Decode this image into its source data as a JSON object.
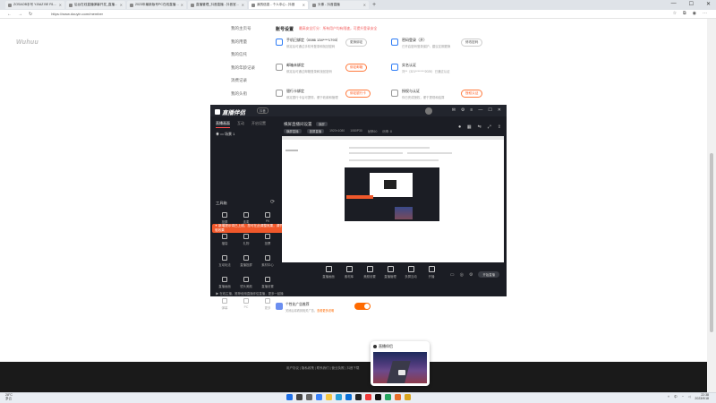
{
  "browser": {
    "tabs": [
      {
        "title": "ZOSAOB手写 Y-BAZ BE R10X...",
        "active": false
      },
      {
        "title": "后台在线直播弹幕开发_直播...",
        "active": false
      },
      {
        "title": "2023年最新版号PC在线直播弹幕...",
        "active": false
      },
      {
        "title": "直播管理_抖音直播 - 抖音官方...",
        "active": false
      },
      {
        "title": "我的信息 - 个人中心 - 抖音",
        "active": true
      },
      {
        "title": "头像 - 抖音直播",
        "active": false
      }
    ],
    "new_tab": "+",
    "url": "https://www.douyin.com/member",
    "nav": {
      "back": "←",
      "forward": "→",
      "reload": "↻"
    },
    "window_controls": {
      "min": "—",
      "max": "☐",
      "close": "✕"
    }
  },
  "page": {
    "logo_text": "Wuhuu",
    "side_menu": [
      "我的主页号",
      "我的用量",
      "我的信托",
      "我的年龄记录",
      "消费记录",
      "我的头衔"
    ],
    "section_title": "账号设置",
    "section_subtitle": "最高安全打分：所有用户均有限速，可提升登录安全",
    "settings": [
      {
        "title": "手机已绑定（0086 134****1793）",
        "desc": "绑定后可通过手机号登录和找回密码",
        "button": "更换绑定",
        "style": "gray"
      },
      {
        "title": "密码登录（开）",
        "desc": "已开启密码登录保护，建议定期更换",
        "button": "修改密码",
        "style": "gray"
      },
      {
        "title": "邮箱未绑定",
        "desc": "绑定后可通过邮箱登录和找回密码",
        "button": "绑定邮箱",
        "style": "orange"
      },
      {
        "title": "实名认证",
        "desc": "刘**（321********2025）已通过认证",
        "button": "",
        "style": "gray"
      },
      {
        "title": "银行卡绑定",
        "desc": "绑定银行卡后可提现，便于收款和管理",
        "button": "绑定银行卡",
        "style": "orange"
      },
      {
        "title": "授权与认证",
        "desc": "你已完成授权，便于提现和结算",
        "button": "授权认证",
        "style": "orange"
      }
    ],
    "marketing": {
      "title": "个性化广告推荐",
      "desc": "关闭后将看到相关广告，",
      "link": "查看更多说明"
    },
    "footer": "用户协议  |  隐私政策  |  联系我们  |  营业执照  |  抖音下载"
  },
  "app": {
    "name": "直播伴侣",
    "tag": "抖音",
    "left_tabs": [
      "直播画面",
      "互动",
      "开启设置"
    ],
    "scene": "场景 1",
    "tools_label": "工具箱",
    "tools": [
      "投屏",
      "连麦",
      "PK",
      "福袋",
      "礼物",
      "投票",
      "互动玩法",
      "直播投屏",
      "素材中心",
      "直播画面",
      "镜头美颜",
      "直播设置",
      "弹幕",
      "PC",
      "更多"
    ],
    "tooltip": "✦ 新增提示词已上线，您可在此调整效果，调节后即可在直播间中体验效果",
    "tooltip_close": "✕",
    "bottom_tip": "▶ 在线主播，推荐使用直播伴侣直播，更多一起播",
    "right_title": "横屏直播间设置",
    "right_tag": "横屏",
    "subbar": [
      "横屏直播",
      "竖屏直播",
      "1920×1080",
      "1080P30",
      "帧率60",
      "码率: 8"
    ],
    "controls": [
      "直播画面",
      "素材库",
      "美颜设置",
      "直播管理",
      "多屏互动",
      "开播"
    ],
    "go_live": "开始直播"
  },
  "popup": {
    "title": "直播伴侣"
  },
  "taskbar": {
    "weather_temp": "28°C",
    "weather_desc": "多云",
    "time": "22:38",
    "date": "2023/9/18",
    "lang": "中"
  },
  "colors": {
    "accent": "#2f7df6",
    "orange": "#ff6a00",
    "tooltip": "#f0582b",
    "app_bg": "#1b1d24"
  }
}
